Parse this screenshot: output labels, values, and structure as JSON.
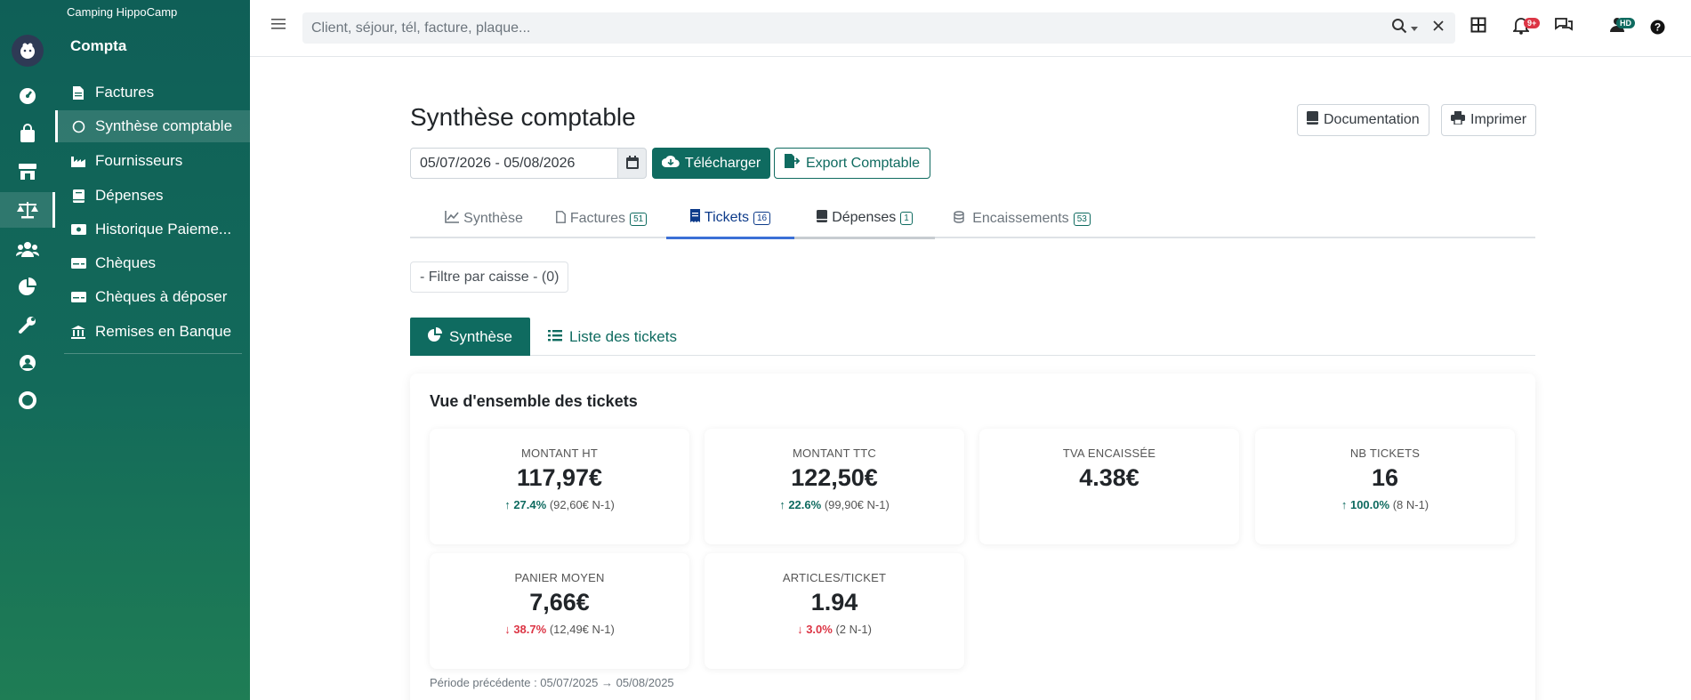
{
  "sidebar": {
    "org_name": "Camping HippoCamp",
    "section_title": "Compta",
    "items": [
      {
        "label": "Factures",
        "icon": "file-icon"
      },
      {
        "label": "Synthèse comptable",
        "icon": "circle-icon"
      },
      {
        "label": "Fournisseurs",
        "icon": "industry-icon"
      },
      {
        "label": "Dépenses",
        "icon": "book-icon"
      },
      {
        "label": "Historique Paieme...",
        "icon": "money-icon"
      },
      {
        "label": "Chèques",
        "icon": "card-icon"
      },
      {
        "label": "Chèques à déposer",
        "icon": "card-icon"
      },
      {
        "label": "Remises en Banque",
        "icon": "bank-icon"
      }
    ]
  },
  "topbar": {
    "search_placeholder": "Client, séjour, tél, facture, plaque...",
    "notifications_badge": "9+",
    "user_initials": "HD"
  },
  "page": {
    "title": "Synthèse comptable",
    "documentation_label": "Documentation",
    "print_label": "Imprimer",
    "date_range": "05/07/2026 - 05/08/2026",
    "download_label": "Télécharger",
    "export_label": "Export Comptable"
  },
  "tabs": [
    {
      "label": "Synthèse",
      "count": ""
    },
    {
      "label": "Factures",
      "count": "51"
    },
    {
      "label": "Tickets",
      "count": "16"
    },
    {
      "label": "Dépenses",
      "count": "1"
    },
    {
      "label": "Encaissements",
      "count": "53"
    }
  ],
  "filter_label": "- Filtre par caisse - (0)",
  "subtabs": {
    "synthese": "Synthèse",
    "list": "Liste des tickets"
  },
  "overview": {
    "title": "Vue d'ensemble des tickets",
    "stats": [
      {
        "label": "MONTANT HT",
        "value": "117,97€",
        "trend": "↑ 27.4%",
        "prev": "(92,60€ N-1)",
        "direction": "up"
      },
      {
        "label": "MONTANT TTC",
        "value": "122,50€",
        "trend": "↑ 22.6%",
        "prev": "(99,90€ N-1)",
        "direction": "up"
      },
      {
        "label": "TVA ENCAISSÉE",
        "value": "4.38€",
        "trend": "",
        "prev": "",
        "direction": "none"
      },
      {
        "label": "NB TICKETS",
        "value": "16",
        "trend": "↑ 100.0%",
        "prev": "(8 N-1)",
        "direction": "up"
      },
      {
        "label": "PANIER MOYEN",
        "value": "7,66€",
        "trend": "↓ 38.7%",
        "prev": "(12,49€ N-1)",
        "direction": "down"
      },
      {
        "label": "ARTICLES/TICKET",
        "value": "1.94",
        "trend": "↓ 3.0%",
        "prev": "(2 N-1)",
        "direction": "down"
      }
    ],
    "previous_period": "Période précédente : 05/07/2025 → 05/08/2025"
  }
}
